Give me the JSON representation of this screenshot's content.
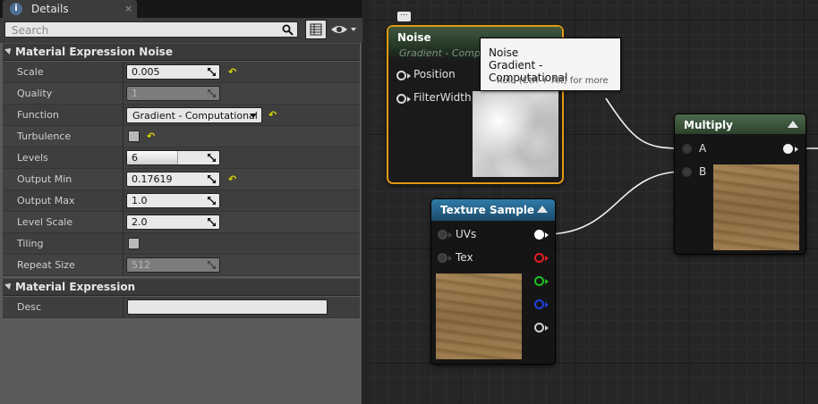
{
  "details_panel": {
    "tab_title": "Details",
    "tab_close": "×",
    "search_placeholder": "Search",
    "sections": [
      {
        "title": "Material Expression Noise",
        "properties": [
          {
            "label": "Scale",
            "type": "number",
            "value": "0.005",
            "reset": true
          },
          {
            "label": "Quality",
            "type": "number",
            "value": "1",
            "disabled": true
          },
          {
            "label": "Function",
            "type": "combo",
            "value": "Gradient - Computational",
            "reset": true
          },
          {
            "label": "Turbulence",
            "type": "checkbox",
            "checked": true,
            "reset": true
          },
          {
            "label": "Levels",
            "type": "slider",
            "value": "6",
            "fill": 0.55
          },
          {
            "label": "Output Min",
            "type": "number",
            "value": "0.17619",
            "reset": true
          },
          {
            "label": "Output Max",
            "type": "number",
            "value": "1.0"
          },
          {
            "label": "Level Scale",
            "type": "number",
            "value": "2.0"
          },
          {
            "label": "Tiling",
            "type": "checkbox",
            "checked": false
          },
          {
            "label": "Repeat Size",
            "type": "number",
            "value": "512",
            "disabled": true
          }
        ]
      },
      {
        "title": "Material Expression",
        "properties": [
          {
            "label": "Desc",
            "type": "text",
            "value": ""
          }
        ]
      }
    ],
    "reset_glyph": "↶"
  },
  "graph": {
    "noise_node": {
      "title": "Noise",
      "subtitle": "Gradient - Computational",
      "pins": [
        "Position",
        "FilterWidth"
      ]
    },
    "tooltip": {
      "line1": "Noise",
      "line2": "Gradient - Computational",
      "hint": "hold (Ctrl + Alt) for more"
    },
    "comment_button": "...",
    "multiply_node": {
      "title": "Multiply",
      "inputs": [
        "A",
        "B"
      ]
    },
    "texture_node": {
      "title": "Texture Sample",
      "inputs": [
        "UVs",
        "Tex"
      ],
      "output_colors": [
        "#ffffff",
        "#e02020",
        "#20c020",
        "#2040e0",
        "#cfcfcf"
      ]
    }
  }
}
